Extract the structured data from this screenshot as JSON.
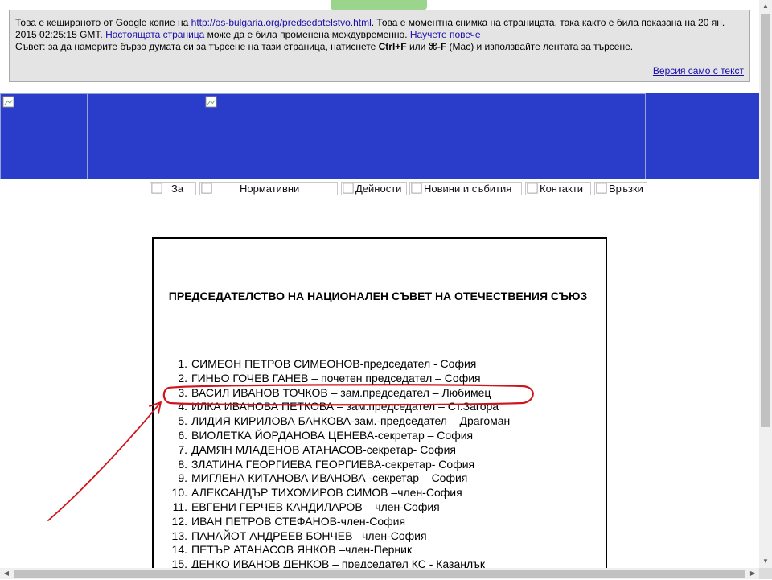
{
  "cache_banner": {
    "line1_prefix": "Това е кешираното от Google копие на ",
    "url": "http://os-bulgaria.org/predsedatelstvo.html",
    "line1_suffix": ". Това е моментна снимка на страницата, така както е била показана на 20 ян.",
    "line2_prefix": "2015 02:25:15 GMT. ",
    "current_page_link": "Настоящата страница",
    "line2_middle": " може да е била променена междувременно. ",
    "learn_more_link": "Научете повече",
    "line3_prefix": "Съвет: за да намерите бързо думата си за търсене на тази страница, натиснете ",
    "shortcut1": "Ctrl+F",
    "line3_or": " или ",
    "shortcut2": "⌘-F",
    "line3_suffix": " (Mac) и използвайте лентата за търсене.",
    "text_only_link": "Версия само с текст"
  },
  "nav": {
    "items": [
      {
        "label": "За"
      },
      {
        "label": "Нормативни"
      },
      {
        "label": "Дейности"
      },
      {
        "label": "Новини и събития"
      },
      {
        "label": "Контакти"
      },
      {
        "label": "Връзки"
      }
    ]
  },
  "content": {
    "title": "ПРЕДСЕДАТЕЛСТВО НА НАЦИОНАЛЕН СЪВЕТ НА ОТЕЧЕСТВЕНИЯ СЪЮЗ",
    "members": [
      {
        "num": "1.",
        "text": "СИМЕОН ПЕТРОВ СИМЕОНОВ-председател - София"
      },
      {
        "num": "2.",
        "text": "ГИНЬО ГОЧЕВ ГАНЕВ – почетен председател – София"
      },
      {
        "num": "3.",
        "text": "ВАСИЛ ИВАНОВ ТОЧКОВ – зам.председател – Любимец"
      },
      {
        "num": "4.",
        "text": "ИЛКА ИВАНОВА ПЕТКОВА – зам.председател – Ст.Загора"
      },
      {
        "num": "5.",
        "text": "ЛИДИЯ КИРИЛОВА БАНКОВА-зам.-председател – Драгоман"
      },
      {
        "num": "6.",
        "text": "ВИОЛЕТКА ЙОРДАНОВА ЦЕНЕВА-секретар – София"
      },
      {
        "num": "7.",
        "text": "ДАМЯН МЛАДЕНОВ АТАНАСОВ-секретар- София"
      },
      {
        "num": "8.",
        "text": "ЗЛАТИНА ГЕОРГИЕВА ГЕОРГИЕВА-секретар- София"
      },
      {
        "num": "9.",
        "text": "МИГЛЕНА КИТАНОВА ИВАНОВА -секретар – София"
      },
      {
        "num": "10.",
        "text": "АЛЕКСАНДЪР ТИХОМИРОВ СИМОВ –член-София"
      },
      {
        "num": "11.",
        "text": "ЕВГЕНИ ГЕРЧЕВ КАНДИЛАРОВ – член-София"
      },
      {
        "num": "12.",
        "text": "ИВАН ПЕТРОВ СТЕФАНОВ-член-София"
      },
      {
        "num": "13.",
        "text": "ПАНАЙОТ АНДРЕЕВ БОНЧЕВ –член-София"
      },
      {
        "num": "14.",
        "text": "ПЕТЪР АТАНАСОВ ЯНКОВ –член-Перник"
      },
      {
        "num": "15.",
        "text": "ДЕНКО ИВАНОВ ДЕНКОВ – председател КС - Казанлък"
      }
    ]
  },
  "annotation": {
    "color": "#d0141b"
  },
  "colors": {
    "header_blue": "#2a3cca",
    "banner_bg": "#e4e4e4",
    "link": "#1a0dab"
  }
}
